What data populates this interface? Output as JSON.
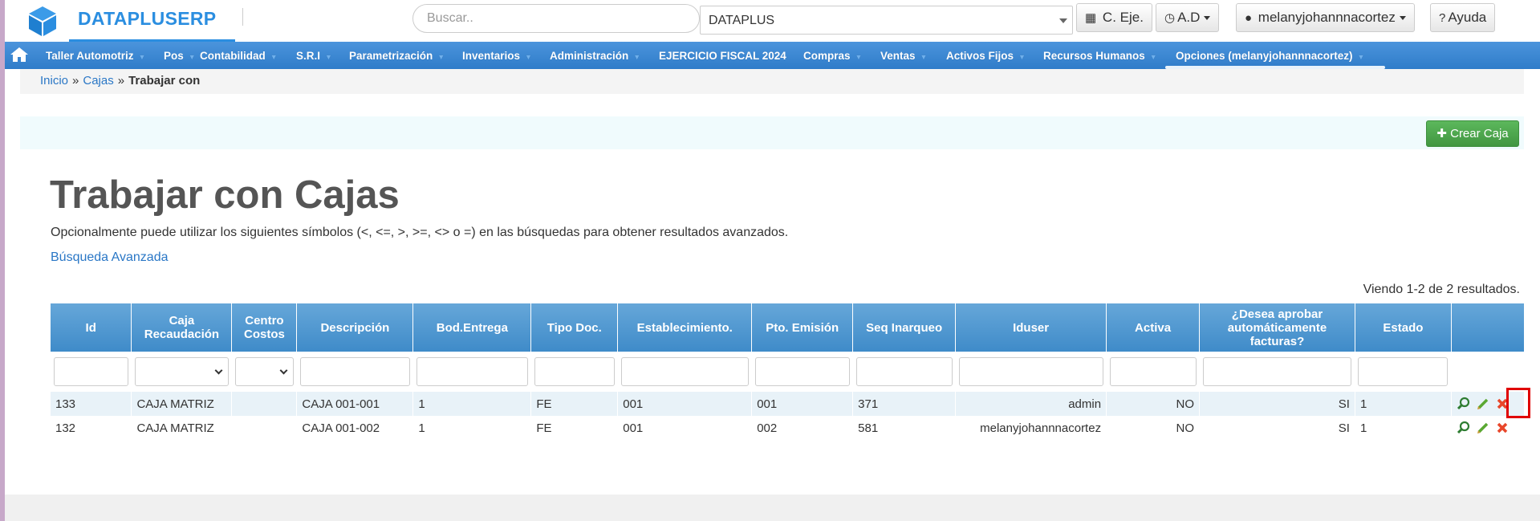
{
  "header": {
    "brand": "DATAPLUSERP",
    "search_placeholder": "Buscar..",
    "company": "DATAPLUS",
    "btn_ejercicio": "C. Eje.",
    "btn_ad": "A.D",
    "user": "melanyjohannnacortez",
    "help": "Ayuda"
  },
  "menu": [
    "Taller Automotriz",
    "Pos",
    "Contabilidad",
    "S.R.I",
    "Parametrización",
    "Inventarios",
    "Administración",
    "EJERCICIO FISCAL 2024",
    "Compras",
    "Ventas",
    "Activos Fijos",
    "Recursos Humanos",
    "Opciones (melanyjohannnacortez)"
  ],
  "breadcrumb": {
    "home": "Inicio",
    "section": "Cajas",
    "current": "Trabajar con",
    "separator": "»"
  },
  "toolbar": {
    "create_label": "Crear Caja"
  },
  "main": {
    "title": "Trabajar con Cajas",
    "hint": "Opcionalmente puede utilizar los siguientes símbolos (<, <=, >, >=, <> o =) en las búsquedas para obtener resultados avanzados.",
    "advanced_search": "Búsqueda Avanzada",
    "summary": "Viendo 1-2 de 2 resultados."
  },
  "table": {
    "columns": [
      "Id",
      "Caja Recaudación",
      "Centro Costos",
      "Descripción",
      "Bod.Entrega",
      "Tipo Doc.",
      "Establecimiento.",
      "Pto. Emisión",
      "Seq Inarqueo",
      "Iduser",
      "Activa",
      "¿Desea aprobar automáticamente facturas?",
      "Estado",
      ""
    ],
    "rows": [
      [
        "133",
        "CAJA MATRIZ",
        "",
        "CAJA 001-001",
        "1",
        "FE",
        "001",
        "001",
        "371",
        "admin",
        "NO",
        "SI",
        "1"
      ],
      [
        "132",
        "CAJA MATRIZ",
        "",
        "CAJA 001-002",
        "1",
        "FE",
        "001",
        "002",
        "581",
        "melanyjohannnacortez",
        "NO",
        "SI",
        "1"
      ]
    ]
  },
  "colors": {
    "brand": "#2b8ee0",
    "menu": "#3a86d2",
    "create": "#4cae4c",
    "header_row": "#4f96cf",
    "highlight": "#e00000"
  },
  "icons": {
    "view": "magnifier-icon",
    "edit": "pencil-icon",
    "delete": "delete-x-icon"
  }
}
